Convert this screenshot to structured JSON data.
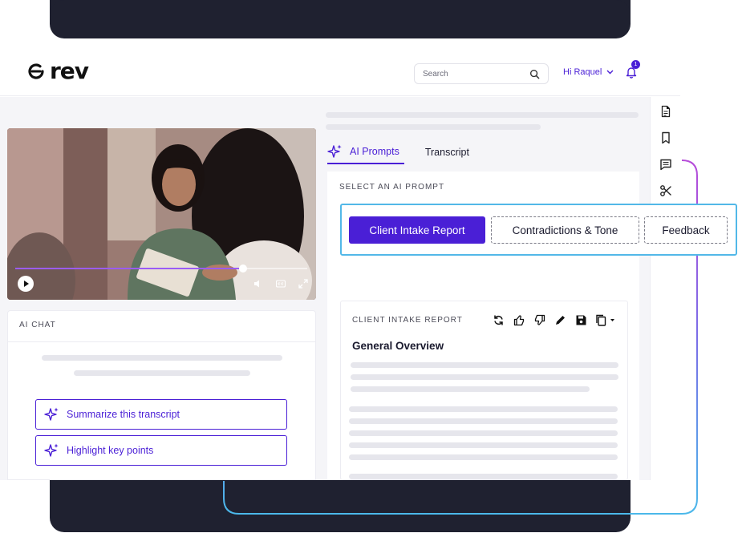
{
  "brand": {
    "name": "rev"
  },
  "header": {
    "search_placeholder": "Search",
    "user_greeting": "Hi Raquel",
    "notification_count": "1"
  },
  "sidebar_icons": [
    "document-icon",
    "bookmark-icon",
    "comment-icon",
    "scissors-icon"
  ],
  "video": {
    "progress": 0.78
  },
  "ai_chat": {
    "title": "AI CHAT",
    "chips": [
      {
        "label": "Summarize this transcript"
      },
      {
        "label": "Highlight key points"
      }
    ]
  },
  "tabs": [
    {
      "label": "AI Prompts",
      "active": true
    },
    {
      "label": "Transcript",
      "active": false
    }
  ],
  "prompt_panel": {
    "label": "SELECT AN AI PROMPT",
    "buttons": [
      {
        "label": "Client Intake Report",
        "selected": true
      },
      {
        "label": "Contradictions & Tone",
        "selected": false
      },
      {
        "label": "Feedback",
        "selected": false
      }
    ]
  },
  "report": {
    "label": "CLIENT INTAKE REPORT",
    "heading": "General Overview"
  },
  "colors": {
    "accent": "#4a1fd6",
    "highlight": "#52b8e8",
    "dark": "#1f2130"
  }
}
